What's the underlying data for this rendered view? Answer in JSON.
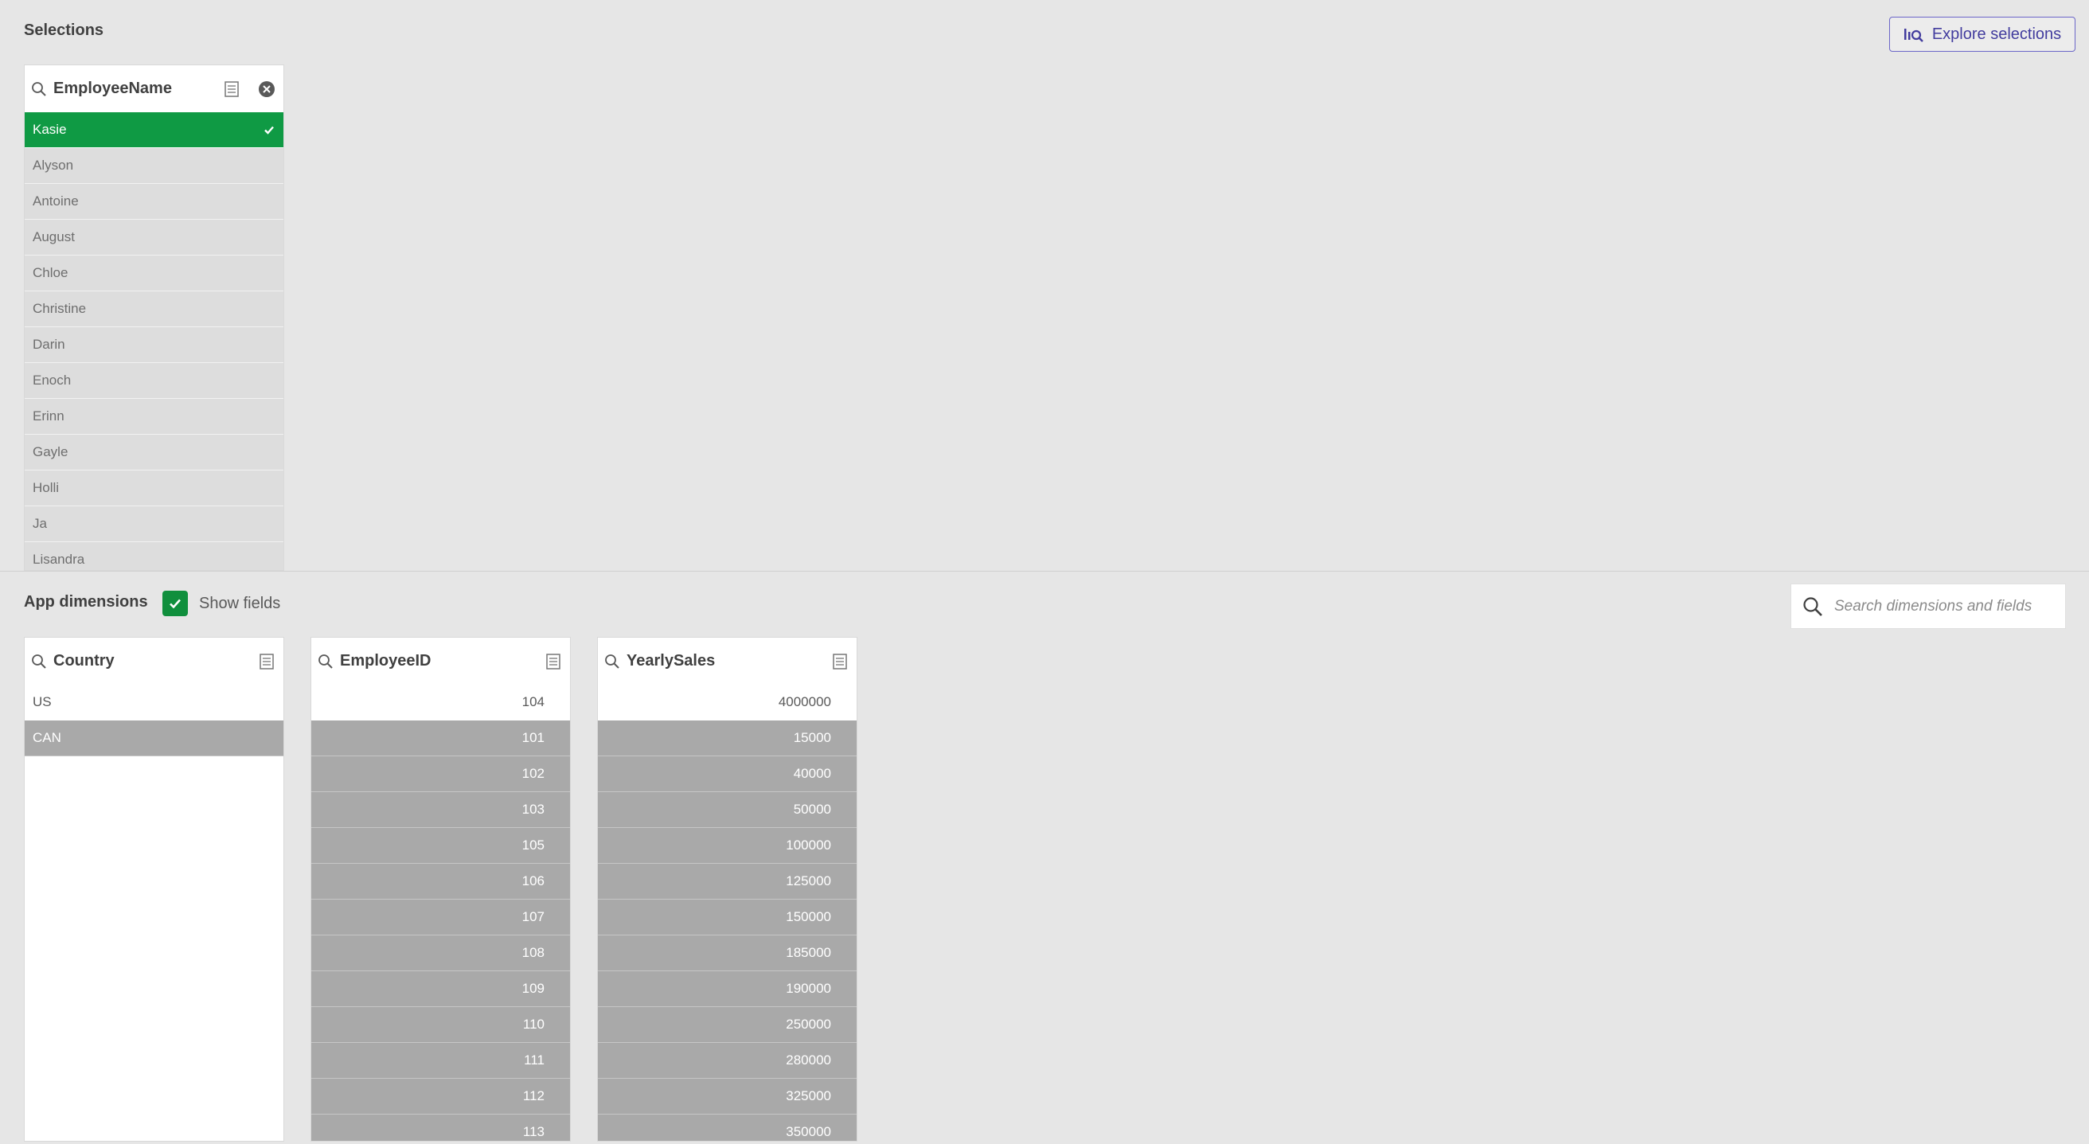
{
  "selections": {
    "title": "Selections",
    "explore_button": "Explore selections"
  },
  "employee_listbox": {
    "title": "EmployeeName",
    "selected": "Kasie",
    "items": [
      "Alyson",
      "Antoine",
      "August",
      "Chloe",
      "Christine",
      "Darin",
      "Enoch",
      "Erinn",
      "Gayle",
      "Holli",
      "Ja",
      "Lisandra"
    ]
  },
  "app_dimensions": {
    "title": "App dimensions",
    "show_fields_label": "Show fields",
    "show_fields_checked": true,
    "search_placeholder": "Search dimensions and fields"
  },
  "country_listbox": {
    "title": "Country",
    "possible": [
      "US"
    ],
    "excluded": [
      "CAN"
    ]
  },
  "employeeid_listbox": {
    "title": "EmployeeID",
    "possible": [
      "104"
    ],
    "excluded": [
      "101",
      "102",
      "103",
      "105",
      "106",
      "107",
      "108",
      "109",
      "110",
      "111",
      "112",
      "113"
    ]
  },
  "yearlysales_listbox": {
    "title": "YearlySales",
    "possible": [
      "4000000"
    ],
    "excluded": [
      "15000",
      "40000",
      "50000",
      "100000",
      "125000",
      "150000",
      "185000",
      "190000",
      "250000",
      "280000",
      "325000",
      "350000"
    ]
  },
  "colors": {
    "selected": "#0f9a44",
    "excluded": "#a9a9a9",
    "alternative": "#dddddd",
    "accent": "#423c9e"
  }
}
